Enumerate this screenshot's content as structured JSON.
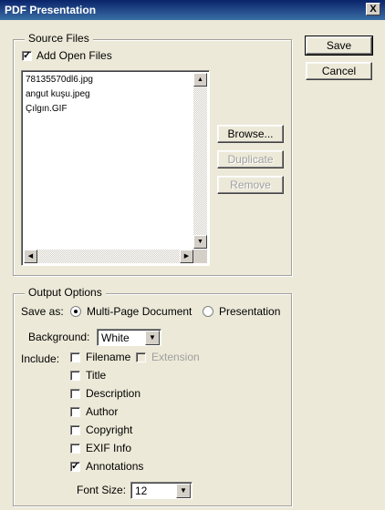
{
  "window": {
    "title": "PDF Presentation",
    "close_glyph": "X"
  },
  "buttons": {
    "save": "Save",
    "cancel": "Cancel",
    "browse": "Browse...",
    "duplicate": "Duplicate",
    "remove": "Remove"
  },
  "source_files": {
    "legend": "Source Files",
    "add_open_files": {
      "label": "Add Open Files",
      "checked": true
    },
    "files": [
      "78135570dl6.jpg",
      "angut kuşu.jpeg",
      "Çılgın.GIF"
    ]
  },
  "output_options": {
    "legend": "Output Options",
    "save_as_label": "Save as:",
    "save_as_options": [
      {
        "label": "Multi-Page Document",
        "selected": true
      },
      {
        "label": "Presentation",
        "selected": false
      }
    ],
    "background_label": "Background:",
    "background_value": "White",
    "include_label": "Include:",
    "include": {
      "filename": {
        "label": "Filename",
        "checked": false
      },
      "extension": {
        "label": "Extension",
        "checked": false,
        "disabled": true
      },
      "title": {
        "label": "Title",
        "checked": false
      },
      "description": {
        "label": "Description",
        "checked": false
      },
      "author": {
        "label": "Author",
        "checked": false
      },
      "copyright": {
        "label": "Copyright",
        "checked": false
      },
      "exif": {
        "label": "EXIF Info",
        "checked": false
      },
      "annotations": {
        "label": "Annotations",
        "checked": true
      }
    },
    "font_size_label": "Font Size:",
    "font_size_value": "12"
  },
  "icons": {
    "check": "✓",
    "scroll_up": "▲",
    "scroll_down": "▼",
    "scroll_left": "◀",
    "scroll_right": "▶",
    "dropdown": "▼"
  }
}
